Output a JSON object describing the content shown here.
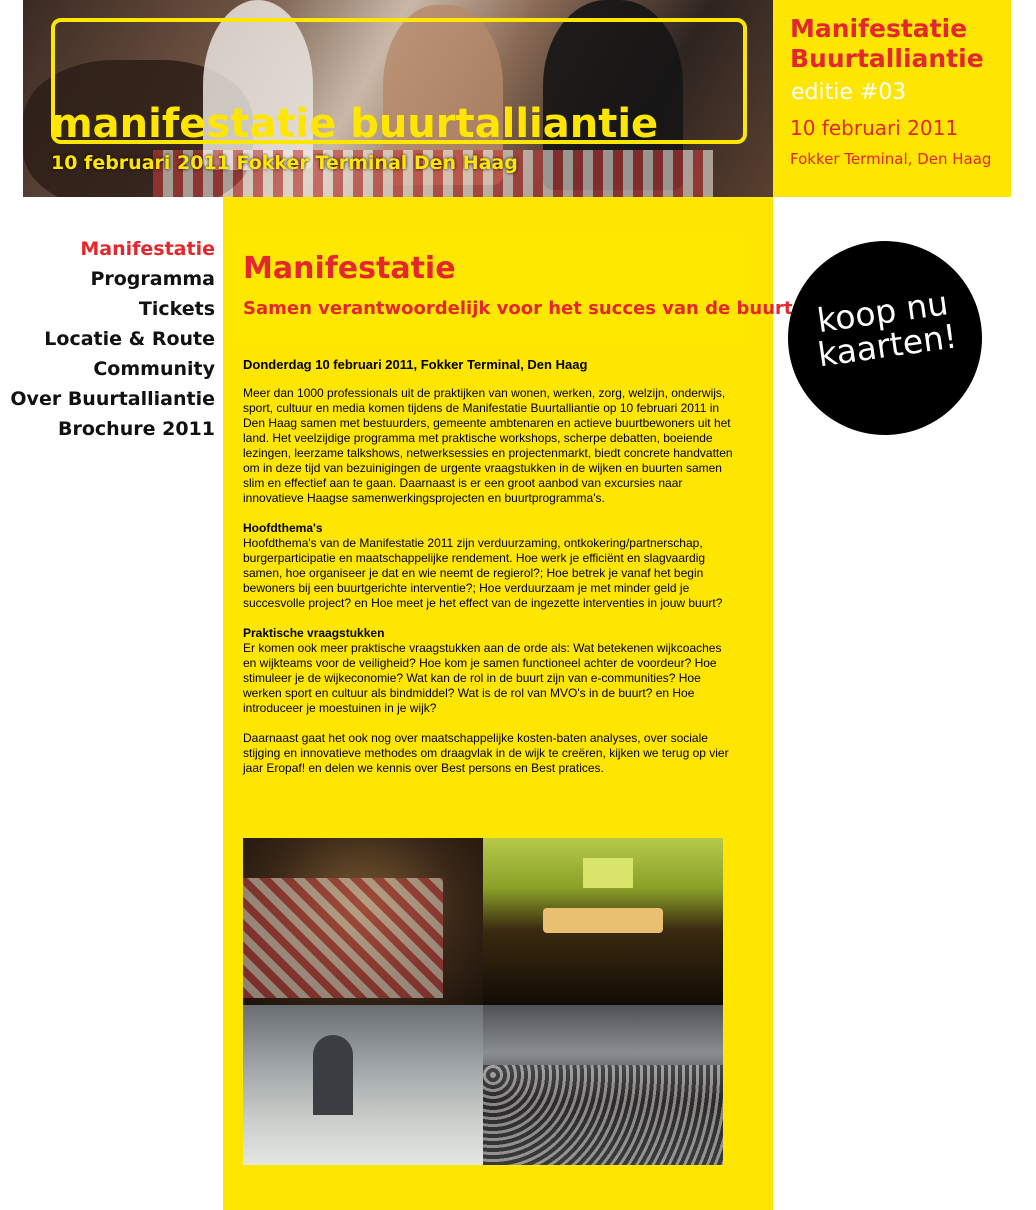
{
  "header": {
    "title": "manifestatie buurtalliantie",
    "subtitle": "10 februari 2011 Fokker Terminal Den Haag"
  },
  "info_box": {
    "line1": "Manifestatie",
    "line2": "Buurtalliantie",
    "edition": "editie #03",
    "date": "10 februari 2011",
    "location": "Fokker Terminal, Den Haag"
  },
  "nav": {
    "items": [
      {
        "label": "Manifestatie",
        "active": true
      },
      {
        "label": "Programma"
      },
      {
        "label": "Tickets"
      },
      {
        "label": "Locatie & Route"
      },
      {
        "label": "Community"
      },
      {
        "label": "Over Buurtalliantie"
      },
      {
        "label": "Brochure 2011"
      }
    ]
  },
  "main": {
    "title": "Manifestatie",
    "subtitle": "Samen verantwoordelijk voor het succes van de buurt",
    "date_line": "Donderdag 10 februari 2011, Fokker Terminal, Den Haag",
    "intro": "Meer dan 1000 professionals uit de praktijken van wonen, werken, zorg, welzijn, onderwijs, sport, cultuur en media komen tijdens de Manifestatie Buurtalliantie op 10 februari 2011 in Den Haag samen met bestuurders, gemeente ambtenaren en actieve buurtbewoners uit het land. Het veelzijdige programma met praktische workshops, scherpe debatten, boeiende lezingen, leerzame talkshows, netwerksessies en projectenmarkt, biedt concrete handvatten om in deze tijd van bezuinigingen de urgente vraagstukken in de wijken en buurten samen slim en effectief aan te gaan. Daarnaast is er een groot aanbod van excursies naar innovatieve Haagse samenwerkingsprojecten en buurtprogramma's.",
    "themes_heading": "Hoofdthema's",
    "themes_text": "Hoofdthema's van de Manifestatie 2011 zijn verduurzaming, ontkokering/partnerschap, burgerparticipatie en maatschappelijke rendement. Hoe werk je efficiënt en slagvaardig samen, hoe organiseer je dat en wie neemt de regierol?; Hoe  betrek je vanaf het begin bewoners bij een buurtgerichte interventie?; Hoe verduurzaam je met minder geld je succesvolle project? en Hoe meet je het effect van de ingezette interventies in jouw buurt?",
    "practical_heading": "Praktische vraagstukken",
    "practical_text": "Er komen ook meer praktische vraagstukken aan de orde als: Wat betekenen wijkcoaches en wijkteams voor de veiligheid? Hoe kom je samen functioneel achter de voordeur? Hoe stimuleer je de wijkeconomie? Wat kan de rol in de buurt zijn van e-communities? Hoe werken sport en cultuur als bindmiddel? Wat is de rol van MVO's in de buurt? en Hoe introduceer je moestuinen in je wijk?",
    "closing_text": "Daarnaast gaat het ook nog over maatschappelijke kosten-baten analyses, over sociale stijging en innovatieve methodes om draagvlak in de wijk te creëren, kijken we terug op vier jaar Eropaf! en delen we kennis over Best persons en Best pratices."
  },
  "badge": {
    "line1": "koop nu",
    "line2": "kaarten!"
  },
  "colors": {
    "yellow": "#ffe600",
    "red": "#e3272d",
    "black": "#000000"
  }
}
